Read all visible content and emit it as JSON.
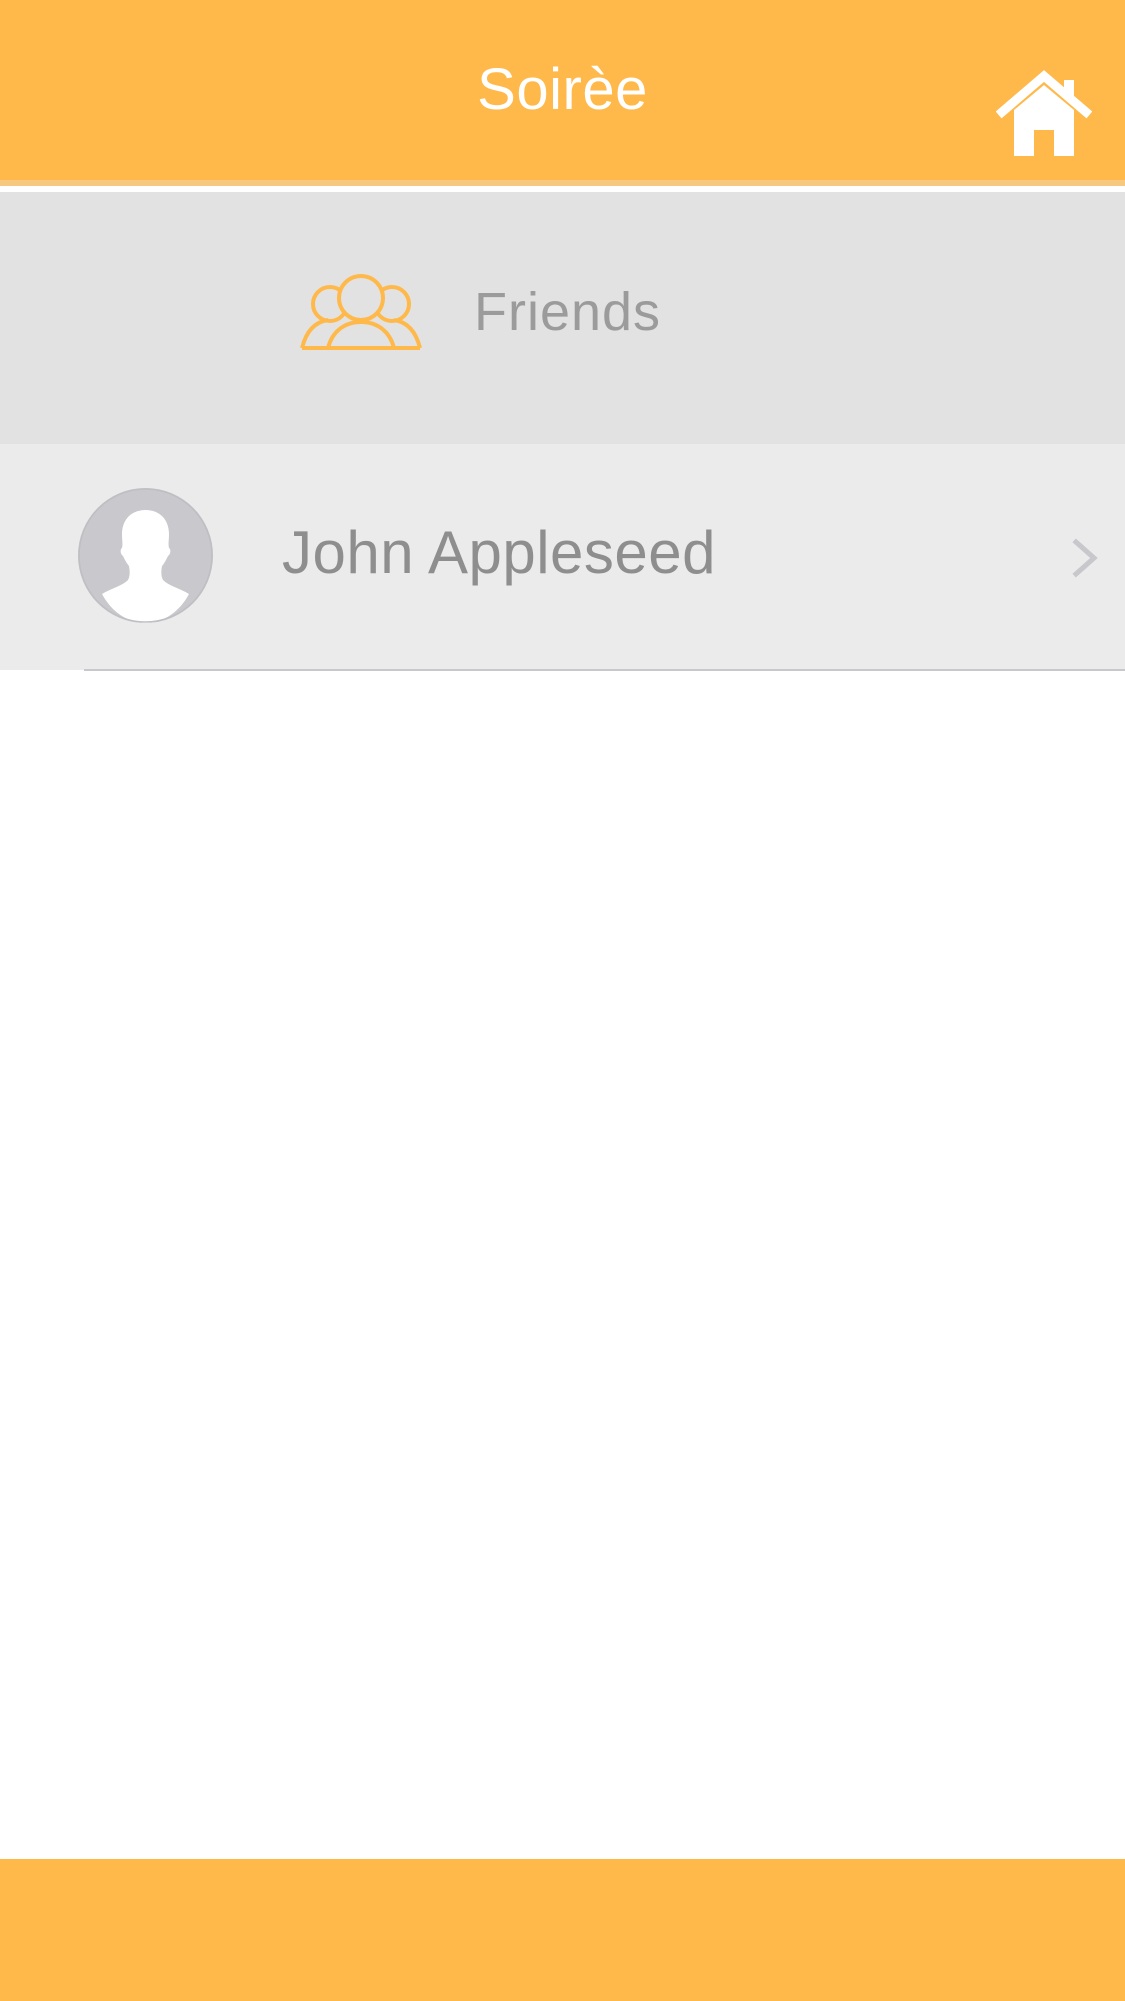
{
  "navbar": {
    "title": "Soirèe",
    "home_icon": "home-icon",
    "background_color": "#FFB94A"
  },
  "section": {
    "title": "Friends",
    "icon": "friends-group-icon",
    "icon_color": "#FFB94A"
  },
  "friends": [
    {
      "name": "John Appleseed",
      "avatar_icon": "default-avatar-icon",
      "accessory_icon": "chevron-right-icon"
    }
  ]
}
